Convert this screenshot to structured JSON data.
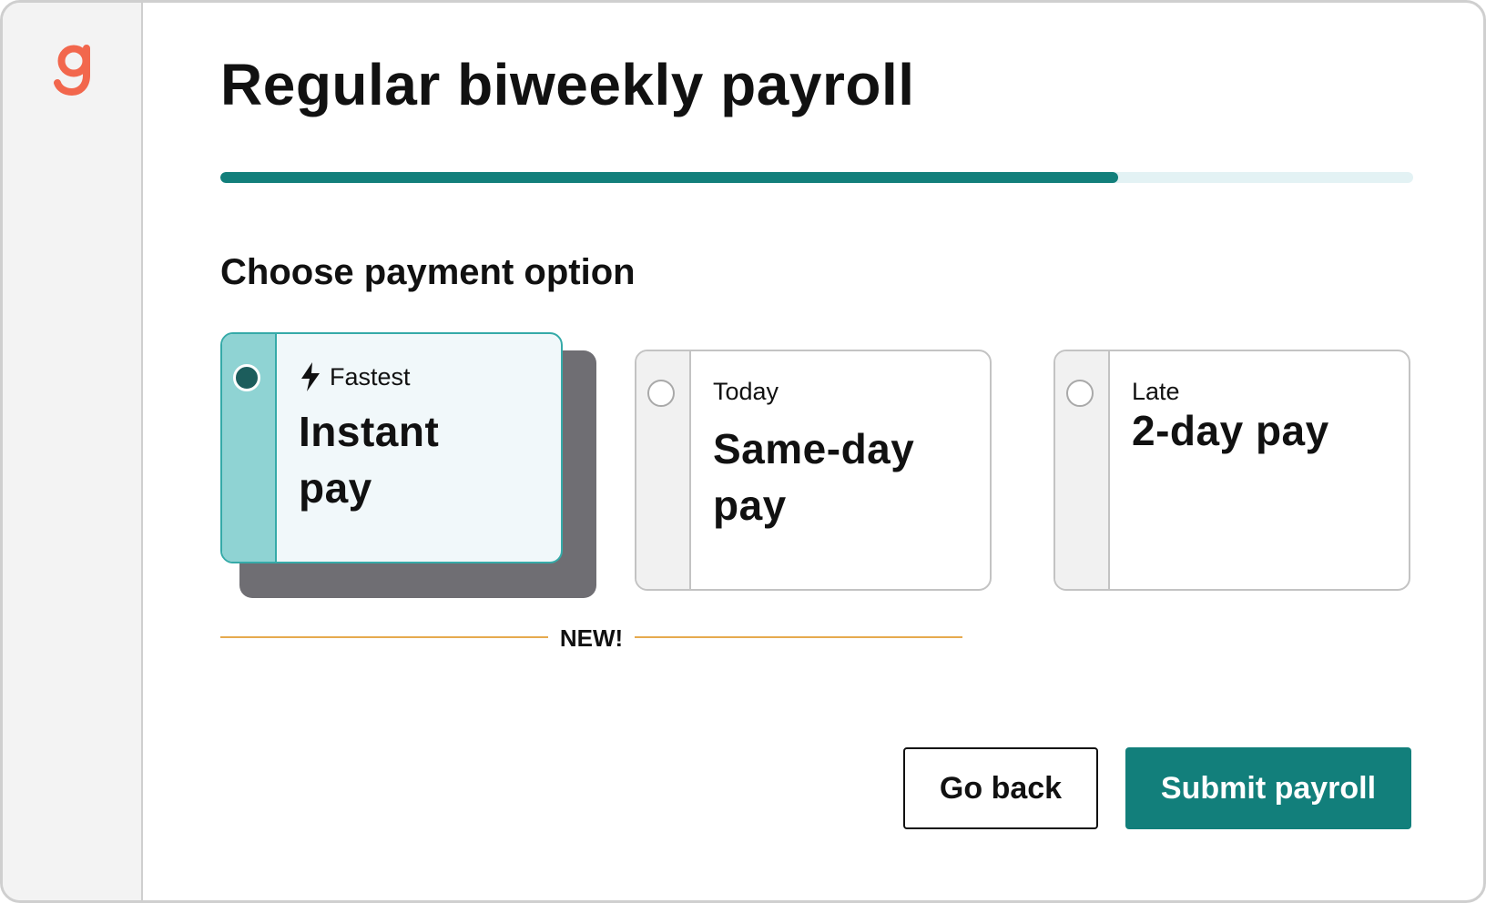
{
  "app": {
    "logo_letter": "g",
    "brand_color": "#f2674d"
  },
  "header": {
    "title": "Regular biweekly payroll"
  },
  "progress": {
    "fraction": 0.753,
    "fill_color": "#127f7b",
    "track_color": "#e3f2f4"
  },
  "section": {
    "title": "Choose payment option"
  },
  "options": [
    {
      "eyebrow": "Fastest",
      "eyebrow_icon": "lightning-bolt-icon",
      "title_line1": "Instant",
      "title_line2": "pay",
      "selected": true
    },
    {
      "eyebrow": "Today",
      "title_line1": "Same-day",
      "title_line2": "pay",
      "selected": false
    },
    {
      "eyebrow": "Late",
      "title_line1": "2-day pay",
      "title_line2": "",
      "selected": false
    }
  ],
  "new_badge": {
    "label": "NEW!",
    "line_color": "#e6aa4e"
  },
  "actions": {
    "back_label": "Go back",
    "submit_label": "Submit payroll"
  }
}
